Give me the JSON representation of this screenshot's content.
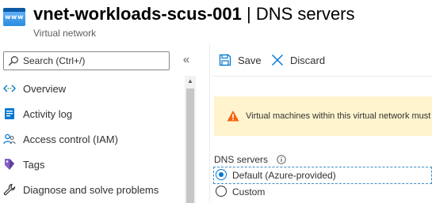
{
  "header": {
    "icon_text": "www",
    "resource_name": "vnet-workloads-scus-001",
    "separator": " | ",
    "blade_title": "DNS servers",
    "subtitle": "Virtual network"
  },
  "sidebar": {
    "search": {
      "placeholder": "Search (Ctrl+/)",
      "value": ""
    },
    "collapse_glyph": "«",
    "items": [
      {
        "label": "Overview",
        "icon": "overview-icon"
      },
      {
        "label": "Activity log",
        "icon": "activity-log-icon"
      },
      {
        "label": "Access control (IAM)",
        "icon": "iam-icon"
      },
      {
        "label": "Tags",
        "icon": "tag-icon"
      },
      {
        "label": "Diagnose and solve problems",
        "icon": "wrench-icon"
      }
    ]
  },
  "toolbar": {
    "save_label": "Save",
    "discard_label": "Discard"
  },
  "warning": {
    "text": "Virtual machines within this virtual network must be restarted to utilize the updated DNS server settings."
  },
  "dns": {
    "label": "DNS servers",
    "options": [
      {
        "label": "Default (Azure-provided)",
        "selected": true
      },
      {
        "label": "Custom",
        "selected": false
      }
    ]
  },
  "colors": {
    "accent": "#0078d4",
    "warning_bg": "#fff4ce",
    "warning_icon": "#f7630c"
  }
}
